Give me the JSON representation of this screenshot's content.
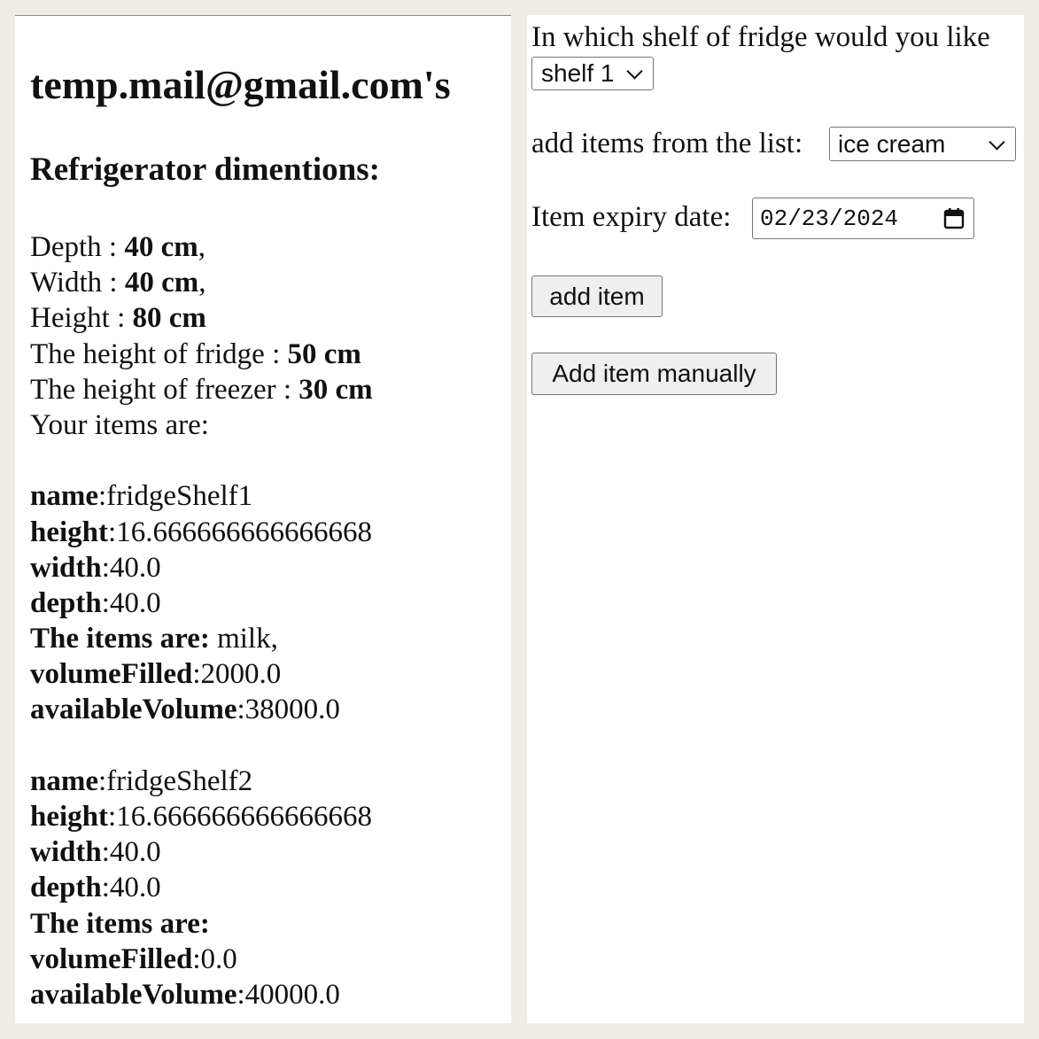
{
  "left": {
    "user_title": "temp.mail@gmail.com's",
    "dims_title": "Refrigerator dimentions:",
    "dims": [
      {
        "label": "Depth : ",
        "value": "40 cm",
        "suffix": ","
      },
      {
        "label": "Width : ",
        "value": "40 cm",
        "suffix": ","
      },
      {
        "label": "Height : ",
        "value": "80 cm",
        "suffix": ""
      },
      {
        "label": "The height of fridge : ",
        "value": "50 cm",
        "suffix": ""
      },
      {
        "label": "The height of freezer : ",
        "value": "30 cm",
        "suffix": ""
      }
    ],
    "items_intro": "Your items are:",
    "labels": {
      "name": "name",
      "height": "height",
      "width": "width",
      "depth": "depth",
      "items": "The items are:",
      "volume_filled": "volumeFilled",
      "available_volume": "availableVolume"
    },
    "shelves": [
      {
        "name": "fridgeShelf1",
        "height": "16.666666666666668",
        "width": "40.0",
        "depth": "40.0",
        "items": " milk,",
        "volume_filled": "2000.0",
        "available_volume": "38000.0"
      },
      {
        "name": "fridgeShelf2",
        "height": "16.666666666666668",
        "width": "40.0",
        "depth": "40.0",
        "items": "",
        "volume_filled": "0.0",
        "available_volume": "40000.0"
      }
    ]
  },
  "right": {
    "shelf_question": "In which shelf of fridge would you like",
    "shelf_select_value": "shelf 1",
    "add_items_label": "add items from the list: ",
    "item_select_value": "ice cream",
    "expiry_label": "Item expiry date: ",
    "expiry_value": "02/23/2024",
    "add_item_button": "add item",
    "add_manual_button": "Add item manually"
  }
}
